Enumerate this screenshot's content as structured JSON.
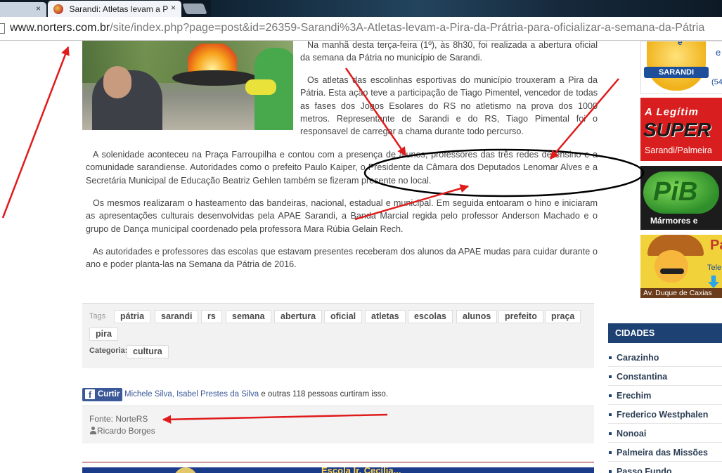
{
  "browser": {
    "active_tab_title": "Sarandi: Atletas levam a P",
    "close_glyph": "×",
    "url_host": "www.norters.com.br",
    "url_path": "/site/index.php?page=post&id=26359-Sarandi%3A-Atletas-levam-a-Pira-da-Prátria-para-oficializar-a-semana-da-Pátria"
  },
  "article": {
    "paragraphs": [
      "Na manhã desta terça-feira (1º), às 8h30, foi realizada a abertura oficial da semana da Pátria no município de Sarandi.",
      "Os atletas das escolinhas esportivas do município trouxeram a Pira da Pátria. Esta ação teve a participação de Tiago Pimentel, vencedor de todas as fases dos Jogos Esolares do RS no atletismo na prova dos 1000 metros. Representante de Sarandi e do RS, Tiago Pimental foi o responsavel de carregar a chama durante todo percurso.",
      "A solenidade aconteceu na Praça Farroupilha e contou com a presença de alunos, professores das três redes de ensino e a comunidade sarandiense. Autoridades como o prefeito Paulo Kaiper, o Presidente da Câmara dos Deputados Lenomar Alves e a Secretária Municipal de Educação Beatriz Gehlen também se fizeram presente no local.",
      "Os mesmos realizaram o hasteamento das bandeiras, nacional, estadual e municipal. Em seguida entoaram o hino e iniciaram as apresentações culturais desenvolvidas pela APAE Sarandi, a Banda Marcial regida pelo professor Anderson Machado e o grupo de Dança municipal coordenado pela professora Mara Rúbia Gelain Rech.",
      "As autoridades e professores das escolas que estavam presentes receberam dos alunos da APAE mudas para cuidar durante o ano e poder planta-las na Semana da Pátria de 2016."
    ],
    "tags_label": "Tags",
    "tags": [
      "pátria",
      "sarandi",
      "rs",
      "semana",
      "abertura",
      "oficial",
      "atletas",
      "escolas",
      "alunos",
      "prefeito",
      "praça",
      "pira"
    ],
    "category_label": "Categoria:",
    "category": "cultura",
    "fb": {
      "button_label": "Curtir",
      "button_icon": "f",
      "friends": "Michele Silva, Isabel Prestes da Silva",
      "rest": " e outras 118 pessoas curtiram isso."
    },
    "source": "Fonte: NorteRS",
    "author": "Ricardo Borges"
  },
  "sidebar": {
    "ads": {
      "sarandi": {
        "badge": "SARANDI",
        "a": "e",
        "b": "e",
        "c": "(54"
      },
      "super": {
        "line1": "A Legítim",
        "line2": "SUPER",
        "line3": "Sarandi/Palmeira"
      },
      "pib": {
        "logo": "PiB",
        "sub": "Mármores e"
      },
      "pizza": {
        "letter": "Pa",
        "tel": "Tele",
        "address": "Av. Duque de Caxias"
      }
    },
    "cidades_title": "CIDADES",
    "cidades": [
      "Carazinho",
      "Constantina",
      "Erechim",
      "Frederico Westphalen",
      "Nonoai",
      "Palmeira das Missões",
      "Passo Fundo"
    ]
  },
  "related": {
    "banner_text": "Escola Ir. Cecília..."
  },
  "colors": {
    "annotation_red": "#e01b1b",
    "sidebar_header": "#1e4173",
    "facebook": "#3b5998"
  }
}
